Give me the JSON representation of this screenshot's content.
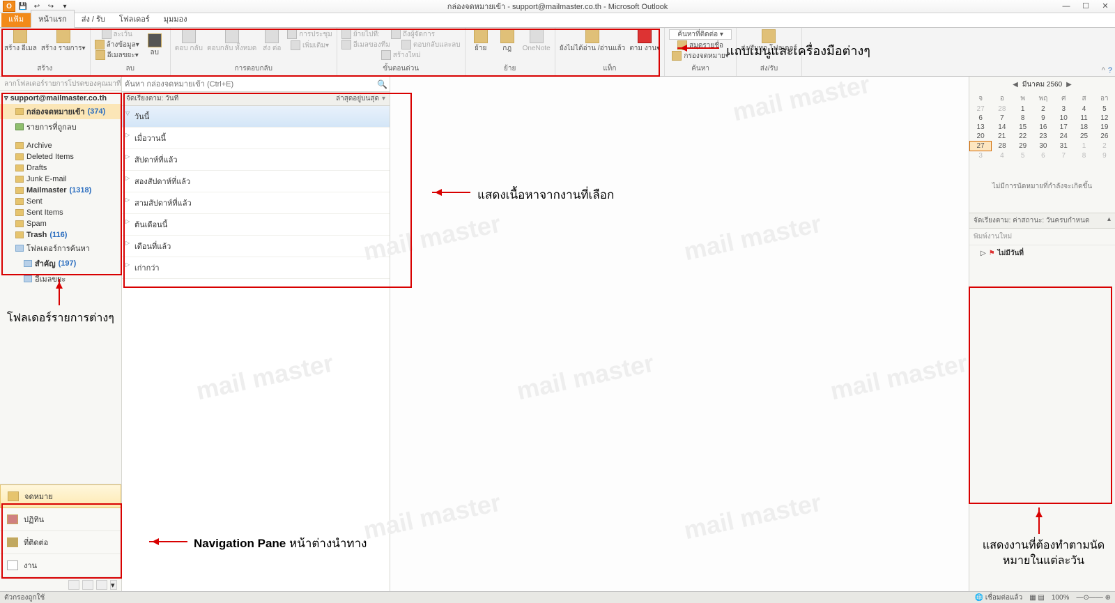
{
  "window": {
    "title": "กล่องจดหมายเข้า - support@mailmaster.co.th - Microsoft Outlook",
    "minimize": "—",
    "maximize": "☐",
    "close": "✕"
  },
  "qat": {
    "app": "O"
  },
  "tabs": {
    "file": "แฟ้ม",
    "home": "หน้าแรก",
    "sendrecv": "ส่ง / รับ",
    "folder": "โฟลเดอร์",
    "view": "มุมมอง"
  },
  "ribbon": {
    "g1": {
      "b1": "สร้าง\nอีเมล",
      "b2": "สร้าง\nรายการ▾",
      "label": "สร้าง"
    },
    "g2": {
      "b1": "ละเว้น",
      "b2": "ล้างข้อมูล▾",
      "b3": "อีเมลขยะ▾",
      "b4": "ลบ",
      "label": "ลบ"
    },
    "g3": {
      "b1": "ตอบ\nกลับ",
      "b2": "ตอบกลับ\nทั้งหมด",
      "b3": "ส่ง\nต่อ",
      "s1": "การประชุม",
      "s2": "เพิ่มเติม▾",
      "label": "การตอบกลับ"
    },
    "g4": {
      "s1": "ย้ายไปที่:",
      "s2": "อีเมลของทีม",
      "s3": "สร้างใหม่",
      "s4": "ถึงผู้จัดการ",
      "s5": "ตอบกลับและลบ",
      "label": "ขั้นตอนด่วน"
    },
    "g5": {
      "b1": "ย้าย",
      "b2": "กฎ",
      "b3": "OneNote",
      "label": "ย้าย"
    },
    "g6": {
      "b1": "ยังไม่ได้อ่าน\n/อ่านแล้ว",
      "b2": "ตาม\nงาน▾",
      "label": "แท็ก"
    },
    "g7": {
      "s1": "ค้นหาที่ติดต่อ ▾",
      "s2": "สมุดรายชื่อ",
      "s3": "กรองจดหมาย▾",
      "label": "ค้นหา"
    },
    "g8": {
      "b1": "ส่ง/รับทุก\nโฟลเดอร์",
      "label": "ส่ง/รับ"
    }
  },
  "leftpane": {
    "header": "ลากโฟลเดอร์รายการโปรดของคุณมาที่▾",
    "account": "support@mailmaster.co.th",
    "inbox": {
      "label": "กล่องจดหมายเข้า",
      "count": "(374)"
    },
    "deletedAll": "รายการที่ถูกลบ",
    "folders": {
      "archive": "Archive",
      "deleted": "Deleted Items",
      "drafts": "Drafts",
      "junk": "Junk E-mail",
      "mailmaster": "Mailmaster",
      "mailmaster_cnt": "(1318)",
      "sent": "Sent",
      "sentitems": "Sent Items",
      "spam": "Spam",
      "trash": "Trash",
      "trash_cnt": "(116)",
      "searchfolders": "โฟลเดอร์การค้นหา",
      "important": "สำคัญ",
      "important_cnt": "(197)",
      "junk2": "อีเมลขยะ"
    }
  },
  "nav": {
    "mail": "จดหมาย",
    "calendar": "ปฏิทิน",
    "contacts": "ที่ติดต่อ",
    "tasks": "งาน"
  },
  "midpane": {
    "searchPlaceholder": "ค้นหา กล่องจดหมายเข้า (Ctrl+E)",
    "sort1": "จัดเรียงตาม: วันที่",
    "sort2": "ล่าสุดอยู่บนสุด",
    "groups": {
      "g0": "วันนี้",
      "g1": "เมื่อวานนี้",
      "g2": "สัปดาห์ที่แล้ว",
      "g3": "สองสัปดาห์ที่แล้ว",
      "g4": "สามสัปดาห์ที่แล้ว",
      "g5": "ต้นเดือนนี้",
      "g6": "เดือนที่แล้ว",
      "g7": "เก่ากว่า"
    }
  },
  "rightpane": {
    "monthTitle": "มีนาคม 2560",
    "dows": {
      "d0": "จ",
      "d1": "อ",
      "d2": "พ",
      "d3": "พฤ",
      "d4": "ศ",
      "d5": "ส",
      "d6": "อา"
    },
    "noappt": "ไม่มีการนัดหมายที่กำลังจะเกิดขึ้น",
    "taskHdr": "จัดเรียงตาม: ค่าสถานะ: วันครบกำหนด",
    "newTask": "พิมพ์งานใหม่",
    "noDateTask": "ไม่มีวันที่"
  },
  "status": {
    "left": "ตัวกรองถูกใช้",
    "conn": "เชื่อมต่อแล้ว",
    "zoom": "100%"
  },
  "callouts": {
    "ribbon": "แถบเมนูและเครื่องมือต่างๆ",
    "folders": "โฟลเดอร์รายการต่างๆ",
    "navpane": "Navigation Pane",
    "navpane2": "หน้าต่างนำทาง",
    "reading": "แสดงเนื้อหาจากงานที่เลือก",
    "tasks": "แสดงงานที่ต้องทำตามนัดหมายในแต่ละวัน"
  },
  "calendar": {
    "rows": [
      [
        {
          "v": "27",
          "dim": true
        },
        {
          "v": "28",
          "dim": true
        },
        {
          "v": "1"
        },
        {
          "v": "2"
        },
        {
          "v": "3"
        },
        {
          "v": "4"
        },
        {
          "v": "5"
        }
      ],
      [
        {
          "v": "6"
        },
        {
          "v": "7"
        },
        {
          "v": "8"
        },
        {
          "v": "9"
        },
        {
          "v": "10"
        },
        {
          "v": "11"
        },
        {
          "v": "12"
        }
      ],
      [
        {
          "v": "13"
        },
        {
          "v": "14"
        },
        {
          "v": "15"
        },
        {
          "v": "16"
        },
        {
          "v": "17"
        },
        {
          "v": "18"
        },
        {
          "v": "19"
        }
      ],
      [
        {
          "v": "20"
        },
        {
          "v": "21"
        },
        {
          "v": "22"
        },
        {
          "v": "23"
        },
        {
          "v": "24"
        },
        {
          "v": "25"
        },
        {
          "v": "26"
        }
      ],
      [
        {
          "v": "27",
          "today": true
        },
        {
          "v": "28"
        },
        {
          "v": "29"
        },
        {
          "v": "30"
        },
        {
          "v": "31"
        },
        {
          "v": "1",
          "dim": true
        },
        {
          "v": "2",
          "dim": true
        }
      ],
      [
        {
          "v": "3",
          "dim": true
        },
        {
          "v": "4",
          "dim": true
        },
        {
          "v": "5",
          "dim": true
        },
        {
          "v": "6",
          "dim": true
        },
        {
          "v": "7",
          "dim": true
        },
        {
          "v": "8",
          "dim": true
        },
        {
          "v": "9",
          "dim": true
        }
      ]
    ]
  }
}
